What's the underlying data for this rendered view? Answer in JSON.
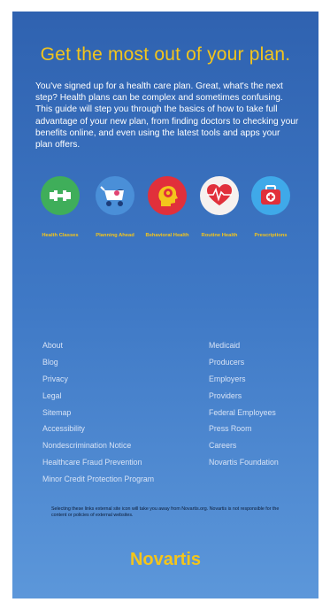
{
  "headline": "Get the most out of your plan.",
  "intro": "You've signed up for a health care plan. Great, what's the next step? Health plans can be complex and sometimes confusing. This guide will step you through the basics of how to take full advantage of your new plan, from finding doctors to checking your benefits online, and even using the latest tools and apps your plan offers.",
  "features": [
    {
      "label": "Health Classes",
      "icon": "dumbbell-icon",
      "color": "#3fae5a"
    },
    {
      "label": "Planning Ahead",
      "icon": "stroller-icon",
      "color": "#4a8fd8"
    },
    {
      "label": "Behavioral Health",
      "icon": "head-icon",
      "color": "#e1303b"
    },
    {
      "label": "Routine Health",
      "icon": "heartbeat-icon",
      "color": "#f6f1ef"
    },
    {
      "label": "Prescriptions",
      "icon": "medkit-icon",
      "color": "#3fa9e9"
    }
  ],
  "footer": {
    "left": [
      "About",
      "Blog",
      "Privacy",
      "Legal",
      "Sitemap",
      "Accessibility",
      "Nondescrimination Notice",
      "Healthcare Fraud Prevention",
      "Minor Credit Protection Program"
    ],
    "right": [
      "Medicaid",
      "Producers",
      "Employers",
      "Providers",
      "Federal Employees",
      "Press Room",
      "Careers",
      "Novartis Foundation"
    ]
  },
  "disclaimer": "Selecting these links external site icon will take you away from Novartis.org. Novartis is not responsible for the content or policies of external websites.",
  "brand": "Novartis"
}
